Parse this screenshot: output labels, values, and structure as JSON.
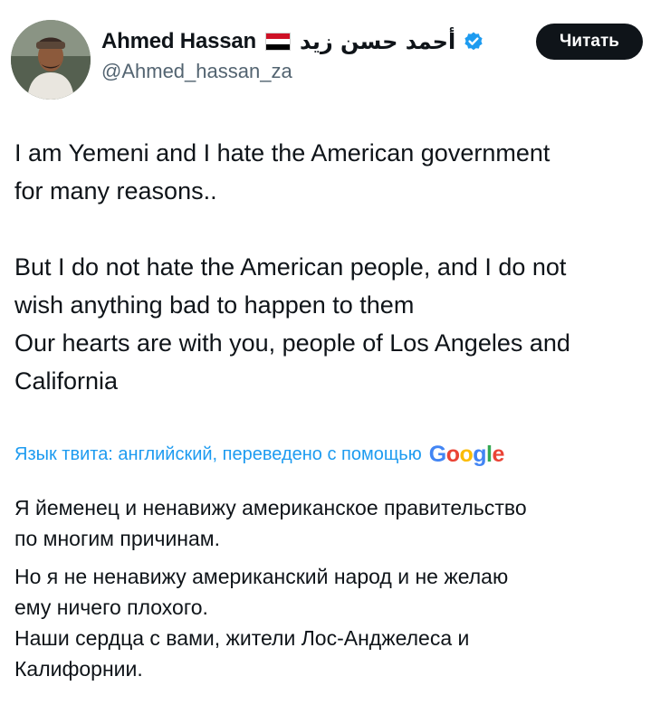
{
  "author": {
    "display_name": "Ahmed Hassan",
    "flag": "flag-yemen-icon",
    "arabic_name": "أحمد حسن زيد",
    "handle": "@Ahmed_hassan_za",
    "verified_color": "#1d9bf0"
  },
  "actions": {
    "read_label": "Читать"
  },
  "tweet": {
    "line1": "I am Yemeni and I hate the American government",
    "line2": "for many reasons..",
    "line3": "But I do not hate the American people, and I do not",
    "line4": "wish anything bad to happen to them",
    "line5": "Our hearts are with you, people of Los Angeles and",
    "line6": "California"
  },
  "translation": {
    "label": "Язык твита: английский, переведено с помощью",
    "provider": "Google",
    "line1": "Я йеменец и ненавижу американское правительство",
    "line2": "по многим причинам.",
    "line3": "Но я не ненавижу американский народ и не желаю",
    "line4": "ему ничего плохого.",
    "line5": "Наши сердца с вами, жители Лос-Анджелеса и",
    "line6": "Калифорнии."
  },
  "colors": {
    "accent": "#1d9bf0",
    "text": "#0f1419",
    "secondary": "#536471",
    "button_bg": "#0f1419"
  }
}
